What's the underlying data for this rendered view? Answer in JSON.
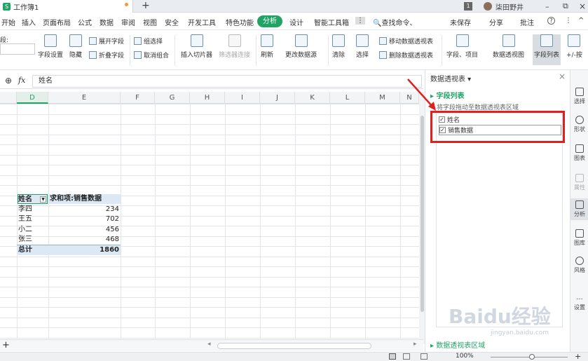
{
  "titlebar": {
    "doc_icon": "S",
    "doc_name": "工作簿1",
    "add_tab": "+",
    "page_badge": "1",
    "user_name": "柒田野井",
    "minimize": "–",
    "restore": "⧉",
    "close": "×"
  },
  "menu": {
    "items": [
      "开始",
      "插入",
      "页面布局",
      "公式",
      "数据",
      "审阅",
      "视图",
      "安全",
      "开发工具",
      "特色功能",
      "分析",
      "设计",
      "智能工具箱"
    ],
    "search": "查找命令、",
    "unsaved": "未保存",
    "share": "分享",
    "comment": "批注",
    "help": "?",
    "more": "⋮",
    "collapse": "^"
  },
  "ribbon": {
    "field_label": "段:",
    "field_settings": "字段设置",
    "hide": "隐藏",
    "expand_field": "展开字段",
    "collapse_field": "折叠字段",
    "group_select": "组选择",
    "ungroup": "取消组合",
    "insert_slicer": "插入切片器",
    "filter_connect": "筛选器连接",
    "refresh": "刷新",
    "change_source": "更改数据源",
    "clear": "清除",
    "select": "选择",
    "move_pivot": "移动数据透视表",
    "delete_pivot": "删除数据透视表",
    "fields_items": "字段、项目",
    "pivot_chart": "数据透视图",
    "field_list": "字段列表",
    "plus_minus": "+/-按"
  },
  "formula": {
    "fx": "fx",
    "value": "姓名"
  },
  "columns": [
    "D",
    "E",
    "F",
    "G",
    "H",
    "I",
    "J",
    "K",
    "L",
    "M",
    "N"
  ],
  "pivot": {
    "header_name": "姓名",
    "header_value": "求和项:销售数据",
    "rows": [
      {
        "name": "李四",
        "value": "234"
      },
      {
        "name": "王五",
        "value": "702"
      },
      {
        "name": "小二",
        "value": "456"
      },
      {
        "name": "张三",
        "value": "468"
      }
    ],
    "total_label": "总计",
    "total_value": "1860"
  },
  "panel": {
    "title": "数据透视表",
    "section_title": "字段列表",
    "hint": "将字段拖动至数据透视表区域",
    "fields": [
      {
        "label": "姓名",
        "checked": true
      },
      {
        "label": "销售数据",
        "checked": true
      }
    ],
    "bottom_link": "数据透视表区域"
  },
  "sidebar": {
    "items": [
      "选择",
      "形状",
      "图表",
      "属性",
      "分析",
      "图库",
      "风格",
      "设置"
    ]
  },
  "status": {
    "zoom": "100%"
  },
  "watermark": {
    "text": "Baidu经验",
    "sub": "jingyan.baidu.com"
  },
  "colors": {
    "accent": "#21a366",
    "highlight_red": "#e02020",
    "pivot_header": "#dce9f5",
    "total_row": "#dce9f5"
  }
}
